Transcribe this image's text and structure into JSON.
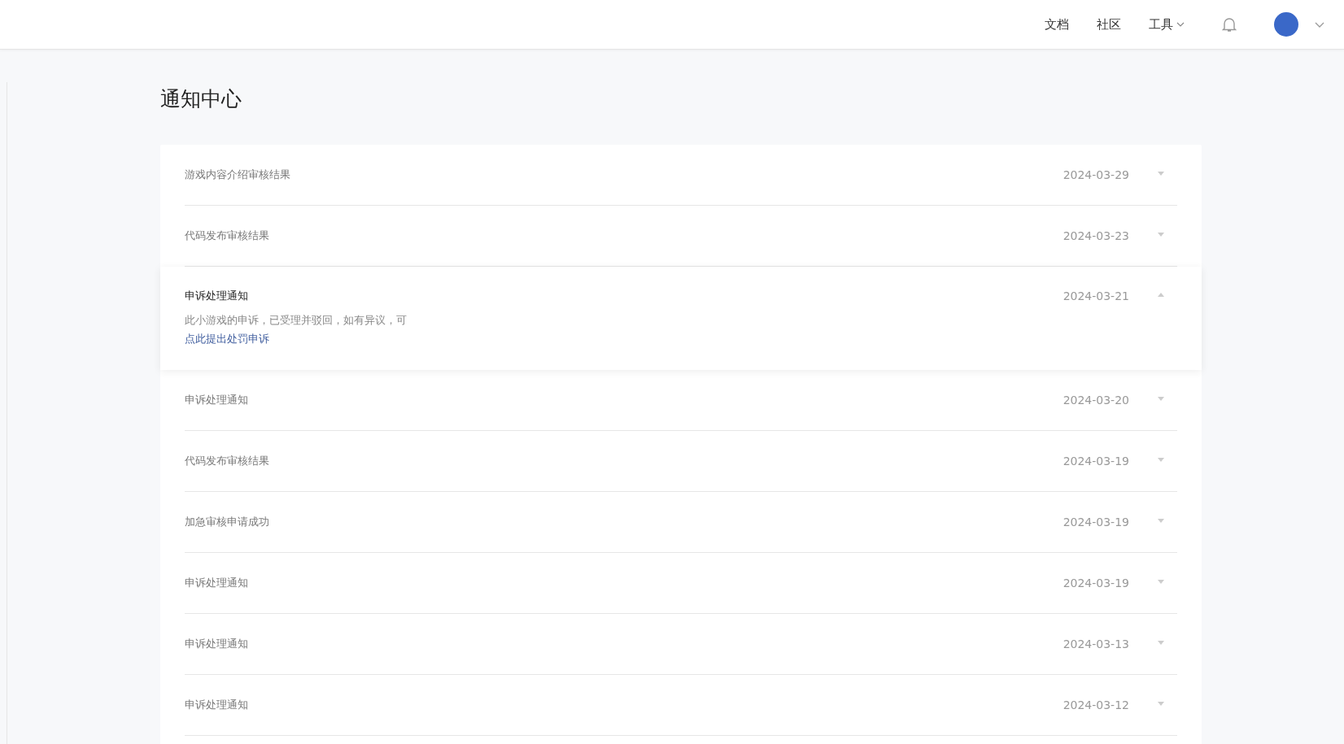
{
  "nav": {
    "links": [
      {
        "label": "文档",
        "dropdown": false
      },
      {
        "label": "社区",
        "dropdown": false
      },
      {
        "label": "工具",
        "dropdown": true
      }
    ]
  },
  "page_title": "通知中心",
  "notifications": [
    {
      "title": "游戏内容介绍审核结果",
      "date": "2024-03-29",
      "expanded": false
    },
    {
      "title": "代码发布审核结果",
      "date": "2024-03-23",
      "expanded": false
    },
    {
      "title": "申诉处理通知",
      "date": "2024-03-21",
      "expanded": true,
      "body": "此小游戏的申诉，已受理并驳回，如有异议，可",
      "link": "点此提出处罚申诉"
    },
    {
      "title": "申诉处理通知",
      "date": "2024-03-20",
      "expanded": false
    },
    {
      "title": "代码发布审核结果",
      "date": "2024-03-19",
      "expanded": false
    },
    {
      "title": "加急审核申请成功",
      "date": "2024-03-19",
      "expanded": false
    },
    {
      "title": "申诉处理通知",
      "date": "2024-03-19",
      "expanded": false
    },
    {
      "title": "申诉处理通知",
      "date": "2024-03-13",
      "expanded": false
    },
    {
      "title": "申诉处理通知",
      "date": "2024-03-12",
      "expanded": false
    }
  ]
}
